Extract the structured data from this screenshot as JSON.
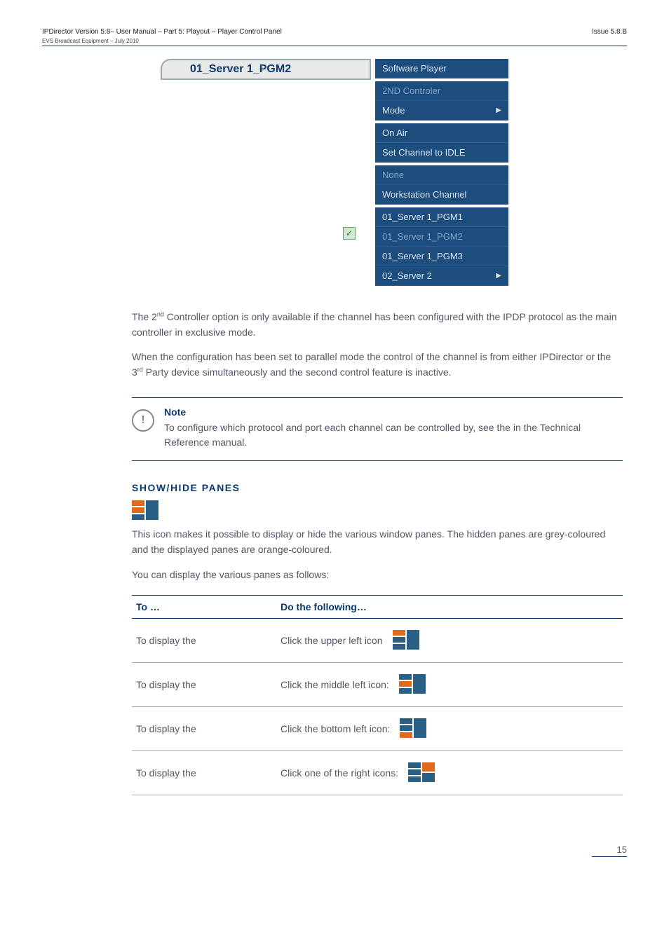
{
  "header": {
    "left": "IPDirector Version 5.8– User Manual – Part 5: Playout – Player Control Panel",
    "sub": "EVS Broadcast Equipment – July 2010",
    "right": "Issue 5.8.B"
  },
  "tab_label": "01_Server 1_PGM2",
  "menu": {
    "software_player": "Software Player",
    "second_controller": "2ND Controler",
    "mode": "Mode",
    "on_air": "On Air",
    "set_idle": "Set Channel to IDLE",
    "none": "None",
    "workstation": "Workstation Channel",
    "pgm1": "01_Server 1_PGM1",
    "pgm2": "01_Server 1_PGM2",
    "pgm3": "01_Server 1_PGM3",
    "server2": "02_Server 2"
  },
  "para1_a": "The 2",
  "para1_sup": "nd",
  "para1_b": " Controller option is only available if the channel has been configured with the IPDP protocol as the main controller in exclusive mode.",
  "para2_a": "When the configuration has been set to parallel mode the control of the channel is from either IPDirector or the 3",
  "para2_sup": "rd",
  "para2_b": " Party device simultaneously and the second control feature is inactive.",
  "note": {
    "head": "Note",
    "body_a": "To configure which protocol and port each channel can be controlled by, see the ",
    "body_b": " in the Technical Reference manual."
  },
  "section_title": "SHOW/HIDE PANES",
  "panes_intro": "This icon makes it possible to display or hide the various window panes. The hidden panes are grey-coloured and the displayed panes are orange-coloured.",
  "panes_follow": "You can display the various panes as follows:",
  "table": {
    "h1": "To …",
    "h2": "Do the following…",
    "r1a": "To display the ",
    "r1c": "Click the upper left icon",
    "r2a": "To display the ",
    "r2c": "Click the middle left icon:",
    "r3a": "To display the ",
    "r3c": "Click the bottom left icon:",
    "r4a": "To display the ",
    "r4c": "Click one of the right icons:"
  },
  "page_num": "15"
}
